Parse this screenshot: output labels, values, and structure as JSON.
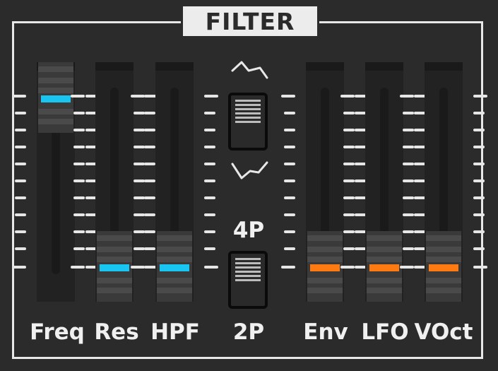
{
  "panel": {
    "title": "FILTER"
  },
  "sliders": [
    {
      "id": "freq",
      "label": "Freq",
      "level": 1.0,
      "light_color": "#19c6f2"
    },
    {
      "id": "res",
      "label": "Res",
      "level": 0.0,
      "light_color": "#19c6f2"
    },
    {
      "id": "hpf",
      "label": "HPF",
      "level": 0.0,
      "light_color": "#19c6f2"
    },
    {
      "id": "env",
      "label": "Env",
      "level": 0.0,
      "light_color": "#ff7a10"
    },
    {
      "id": "lfo",
      "label": "LFO",
      "level": 0.0,
      "light_color": "#ff7a10"
    },
    {
      "id": "voct",
      "label": "VOct",
      "level": 0.0,
      "light_color": "#ff7a10"
    }
  ],
  "mode_switch": {
    "top_icon": "lowpass-curve-icon",
    "bottom_icon": "highpass-curve-icon",
    "position": "up"
  },
  "pole_switch": {
    "top_label": "4P",
    "bottom_label": "2P",
    "position": "down"
  },
  "colors": {
    "background": "#2b2b2b",
    "frame": "#e8e8e8",
    "tick": "#e6e6e6",
    "cyan_light": "#19c6f2",
    "orange_light": "#ff7a10"
  }
}
